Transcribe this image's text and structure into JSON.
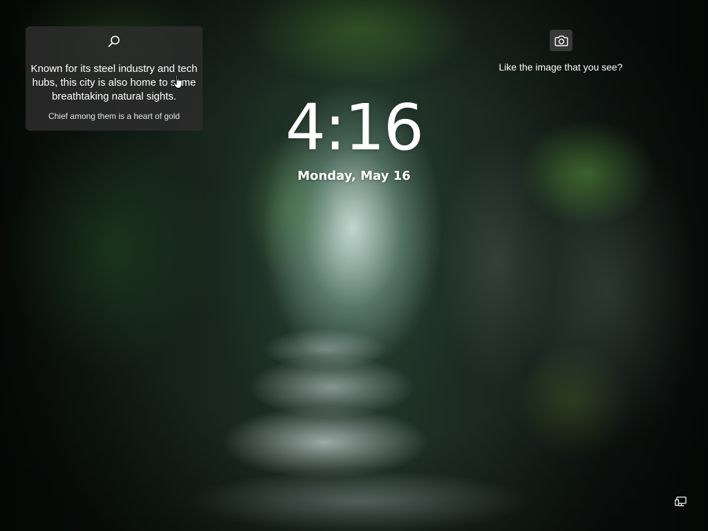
{
  "lock_screen": {
    "time": "4:16",
    "date": "Monday, May 16"
  },
  "info_card": {
    "icon": "search-icon",
    "headline": "Known for its steel industry and tech hubs, this city is also home to some breathtaking natural sights.",
    "subtext": "Chief among them is a heart of gold"
  },
  "spotlight": {
    "icon": "camera-icon",
    "prompt": "Like the image that you see?"
  },
  "system_tray": {
    "network_icon": "network-icon"
  },
  "colors": {
    "text": "#ffffff",
    "card_background": "#2c2c2c",
    "camera_button_background": "#464646"
  }
}
